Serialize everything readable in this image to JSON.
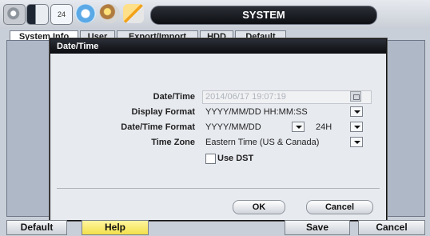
{
  "toolbar": {
    "icons": [
      "settings-gear-icon",
      "video-toggle-icon",
      "calendar-icon",
      "network-icon",
      "disk-icon",
      "tools-icon"
    ],
    "calendar_text": "24"
  },
  "window": {
    "title": "SYSTEM"
  },
  "tabs": [
    {
      "label": "System Info",
      "active": true
    },
    {
      "label": "User",
      "active": false
    },
    {
      "label": "Export/Import",
      "active": false
    },
    {
      "label": "HDD",
      "active": false
    },
    {
      "label": "Default",
      "active": false
    }
  ],
  "dialog": {
    "title": "Date/Time",
    "datetime_label": "Date/Time",
    "datetime_value": "2014/06/17 19:07:19",
    "display_format_label": "Display Format",
    "display_format_value": "YYYY/MM/DD HH:MM:SS",
    "datetime_format_label": "Date/Time Format",
    "date_format_value": "YYYY/MM/DD",
    "hour_format_value": "24H",
    "time_zone_label": "Time Zone",
    "time_zone_value": "Eastern Time (US & Canada)",
    "use_dst_label": "Use DST",
    "use_dst_checked": false,
    "ok_label": "OK",
    "cancel_label": "Cancel"
  },
  "bottom": {
    "default_label": "Default",
    "help_label": "Help",
    "save_label": "Save",
    "cancel_label": "Cancel"
  },
  "colors": {
    "help_button": "#f2e04b",
    "title_bar": "#0d0f13"
  }
}
